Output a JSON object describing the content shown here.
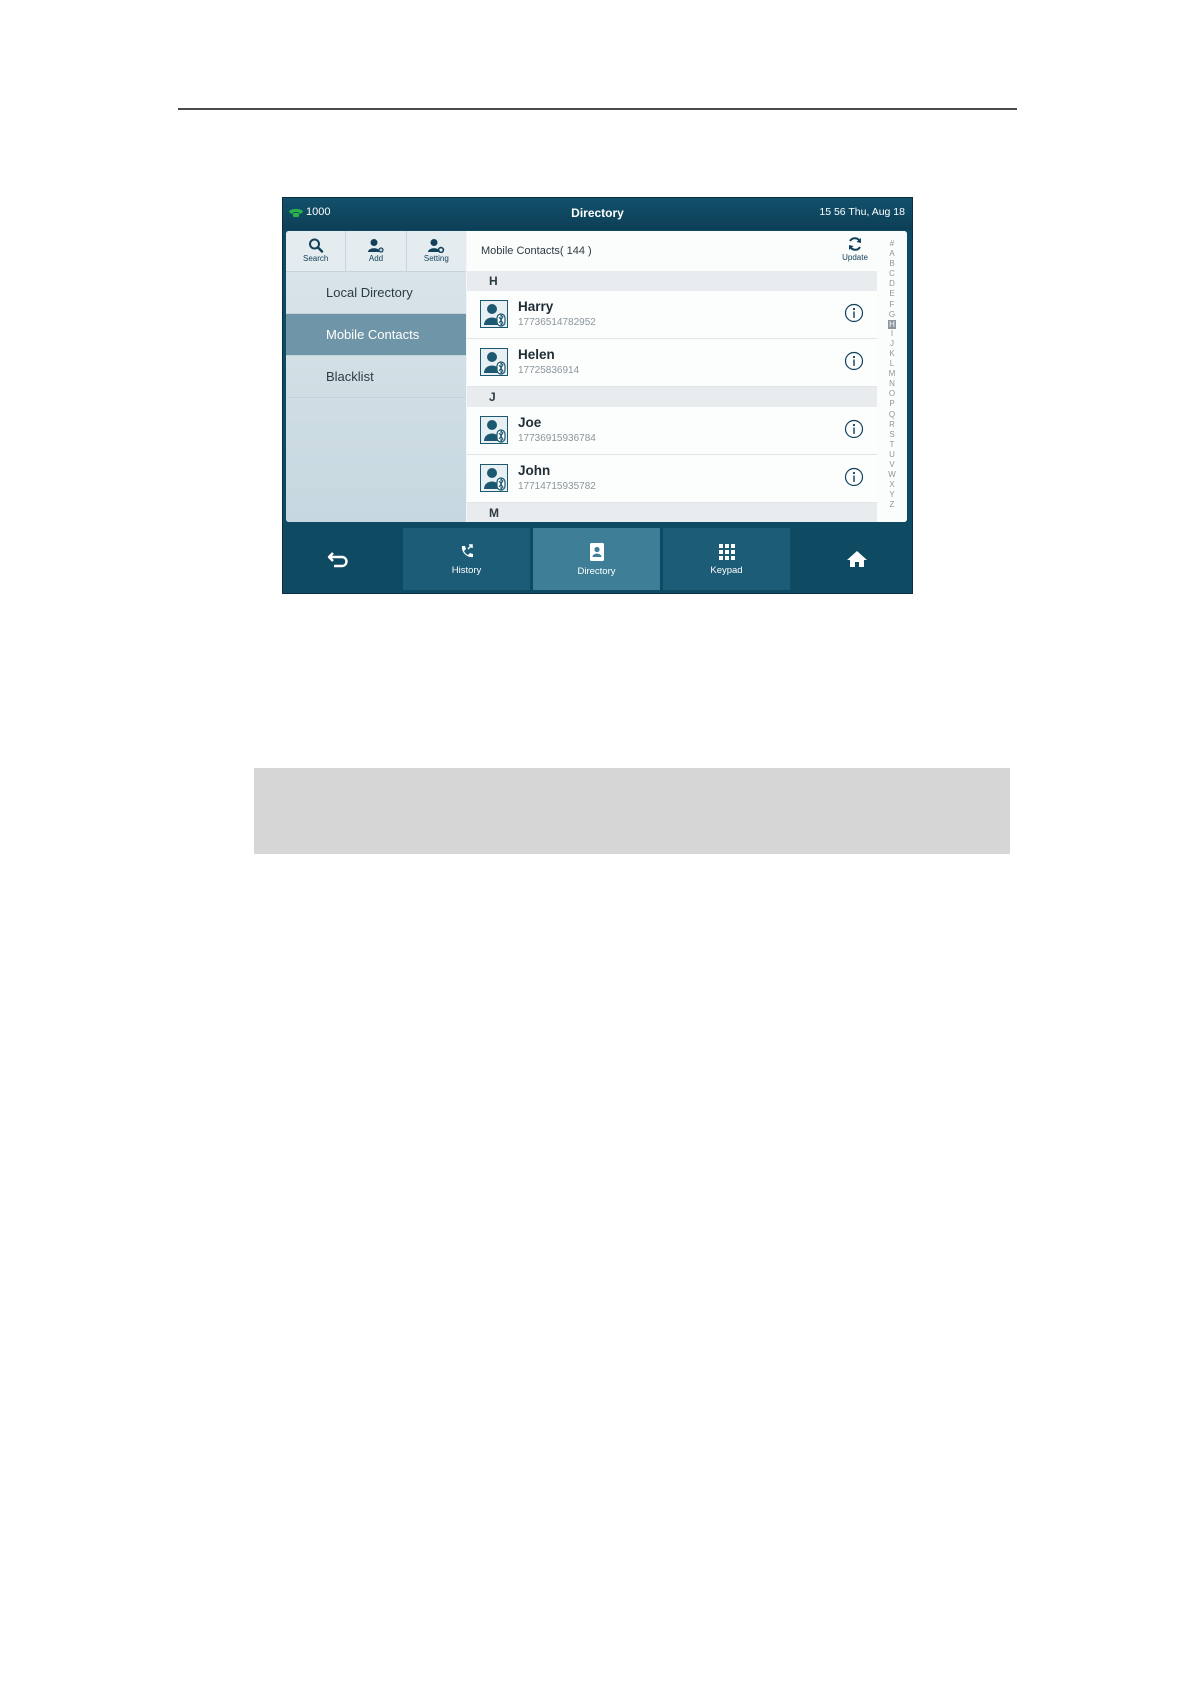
{
  "status_bar": {
    "line_number": "1000",
    "title": "Directory",
    "datetime": "15 56 Thu, Aug 18"
  },
  "toolbar": {
    "search_label": "Search",
    "add_label": "Add",
    "setting_label": "Setting"
  },
  "menu": {
    "items": [
      {
        "label": "Local Directory",
        "active": false
      },
      {
        "label": "Mobile Contacts",
        "active": true
      },
      {
        "label": "Blacklist",
        "active": false
      }
    ]
  },
  "list": {
    "title": "Mobile Contacts( 144 )",
    "update_label": "Update",
    "sections": [
      {
        "letter": "H",
        "contacts": [
          {
            "name": "Harry",
            "number": "17736514782952"
          },
          {
            "name": "Helen",
            "number": "17725836914"
          }
        ]
      },
      {
        "letter": "J",
        "contacts": [
          {
            "name": "Joe",
            "number": "17736915936784"
          },
          {
            "name": "John",
            "number": "17714715935782"
          }
        ]
      },
      {
        "letter": "M",
        "contacts": []
      }
    ]
  },
  "alphabet": [
    "#",
    "A",
    "B",
    "C",
    "D",
    "E",
    "F",
    "G",
    "H",
    "I",
    "J",
    "K",
    "L",
    "M",
    "N",
    "O",
    "P",
    "Q",
    "R",
    "S",
    "T",
    "U",
    "V",
    "W",
    "X",
    "Y",
    "Z"
  ],
  "alphabet_selected": "H",
  "navbar": {
    "history_label": "History",
    "directory_label": "Directory",
    "keypad_label": "Keypad",
    "active_tab": "Directory"
  },
  "colors": {
    "screen_bg": "#0f4a63",
    "active_menu": "#6f96a8",
    "active_nav": "#3e7f97",
    "line_icon": "#29b34a"
  }
}
